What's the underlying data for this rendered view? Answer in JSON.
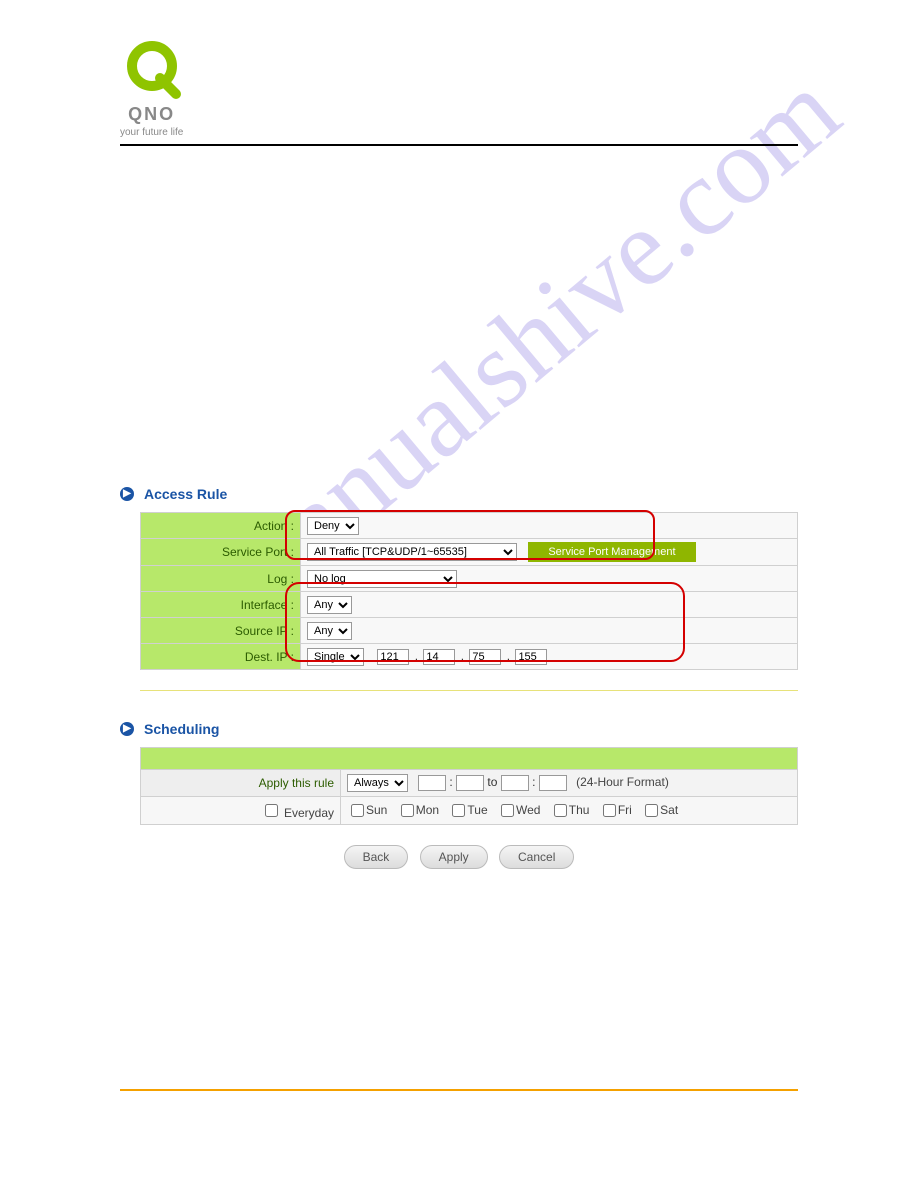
{
  "brand": {
    "name": "QNO",
    "tagline": "your future life"
  },
  "watermark": "manualshive.com",
  "sections": {
    "access_rule": {
      "title": "Access Rule",
      "rows": {
        "action": {
          "label": "Action :",
          "value": "Deny"
        },
        "service_port": {
          "label": "Service Port :",
          "value": "All Traffic [TCP&UDP/1~65535]",
          "button": "Service Port Management"
        },
        "log": {
          "label": "Log :",
          "value": "No log"
        },
        "interface": {
          "label": "Interface :",
          "value": "Any"
        },
        "source_ip": {
          "label": "Source IP :",
          "value": "Any"
        },
        "dest_ip": {
          "label": "Dest. IP :",
          "value": "Single",
          "octets": [
            "121",
            "14",
            "75",
            "155"
          ]
        }
      }
    },
    "scheduling": {
      "title": "Scheduling",
      "apply_label": "Apply this rule",
      "apply_value": "Always",
      "time_from_h": "",
      "time_from_m": "",
      "time_to_h": "",
      "time_to_m": "",
      "to_text": "to",
      "colon": ":",
      "format_note": "(24-Hour Format)",
      "everyday_label": "Everyday",
      "days": [
        "Sun",
        "Mon",
        "Tue",
        "Wed",
        "Thu",
        "Fri",
        "Sat"
      ]
    }
  },
  "buttons": {
    "back": "Back",
    "apply": "Apply",
    "cancel": "Cancel"
  }
}
